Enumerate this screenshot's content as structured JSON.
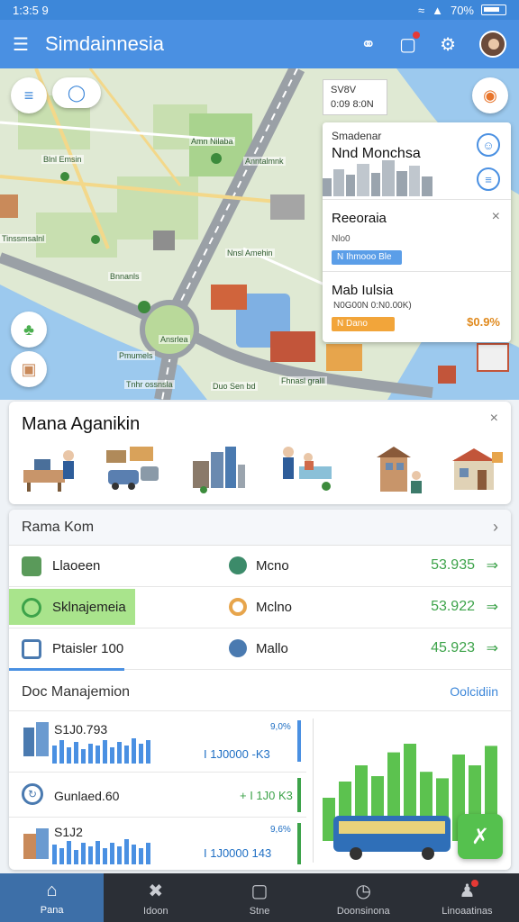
{
  "status_bar": {
    "time": "1:3:5 9",
    "battery": "70%"
  },
  "app_bar": {
    "title": "Simdainnesia"
  },
  "map": {
    "labels": [
      "Amn Nilaba",
      "Blnl Emsin",
      "Bnnanls",
      "Nnsl Amehin",
      "Ansrlea",
      "Tinssmsalnl",
      "Tnhr ossnsla",
      "Pmumels",
      "Fhnasl gralll",
      "Anntalmnk",
      "Duo Sen bd"
    ],
    "small_tag": {
      "line1": "SV8V",
      "line2": "0:09 8:0N"
    }
  },
  "side_card": {
    "sec1": {
      "small": "Smadenar",
      "big": "Nnd Monchsa"
    },
    "sec2": {
      "title": "Reeoraia",
      "sub": "Nlo0",
      "pill": "N Ihmooo Ble"
    },
    "sec3": {
      "title": "Mab Iulsia",
      "detail": "N0G00N 0:N0.00K)",
      "pill": "N Dano",
      "pct": "$0.9%"
    }
  },
  "panel": {
    "title": "Mana Aganikin"
  },
  "list": {
    "header": "Rama Kom",
    "rows": [
      {
        "left": "Llaoeen",
        "right": "Mcno",
        "value": "53.935"
      },
      {
        "left": "Sklnajemeia",
        "right": "Mclno",
        "value": "53.922"
      },
      {
        "left": "Ptaisler 100",
        "right": "Mallo",
        "value": "45.923"
      }
    ],
    "doc": {
      "title": "Doc Manajemion",
      "right": "Oolcidiin"
    },
    "stats": [
      {
        "amount": "S1J0.793",
        "top": "9,0%",
        "sub": "I 1J0000 -K3"
      },
      {
        "amount": "Gunlaed.60",
        "sub": "+ I 1J0 K3"
      },
      {
        "amount": "S1J2",
        "top": "9,6%",
        "sub": "I 1J0000 143"
      }
    ],
    "big_chart_values": [
      40,
      55,
      70,
      60,
      82,
      90,
      64,
      58,
      80,
      70,
      88
    ]
  },
  "bottom_nav": [
    {
      "label": "Pana",
      "icon": "home-icon",
      "active": true
    },
    {
      "label": "Idoon",
      "icon": "tools-icon",
      "active": false
    },
    {
      "label": "Stne",
      "icon": "square-icon",
      "active": false
    },
    {
      "label": "Doonsinona",
      "icon": "clock-icon",
      "active": false
    },
    {
      "label": "Linoaatinas",
      "icon": "person-icon",
      "active": false
    }
  ]
}
